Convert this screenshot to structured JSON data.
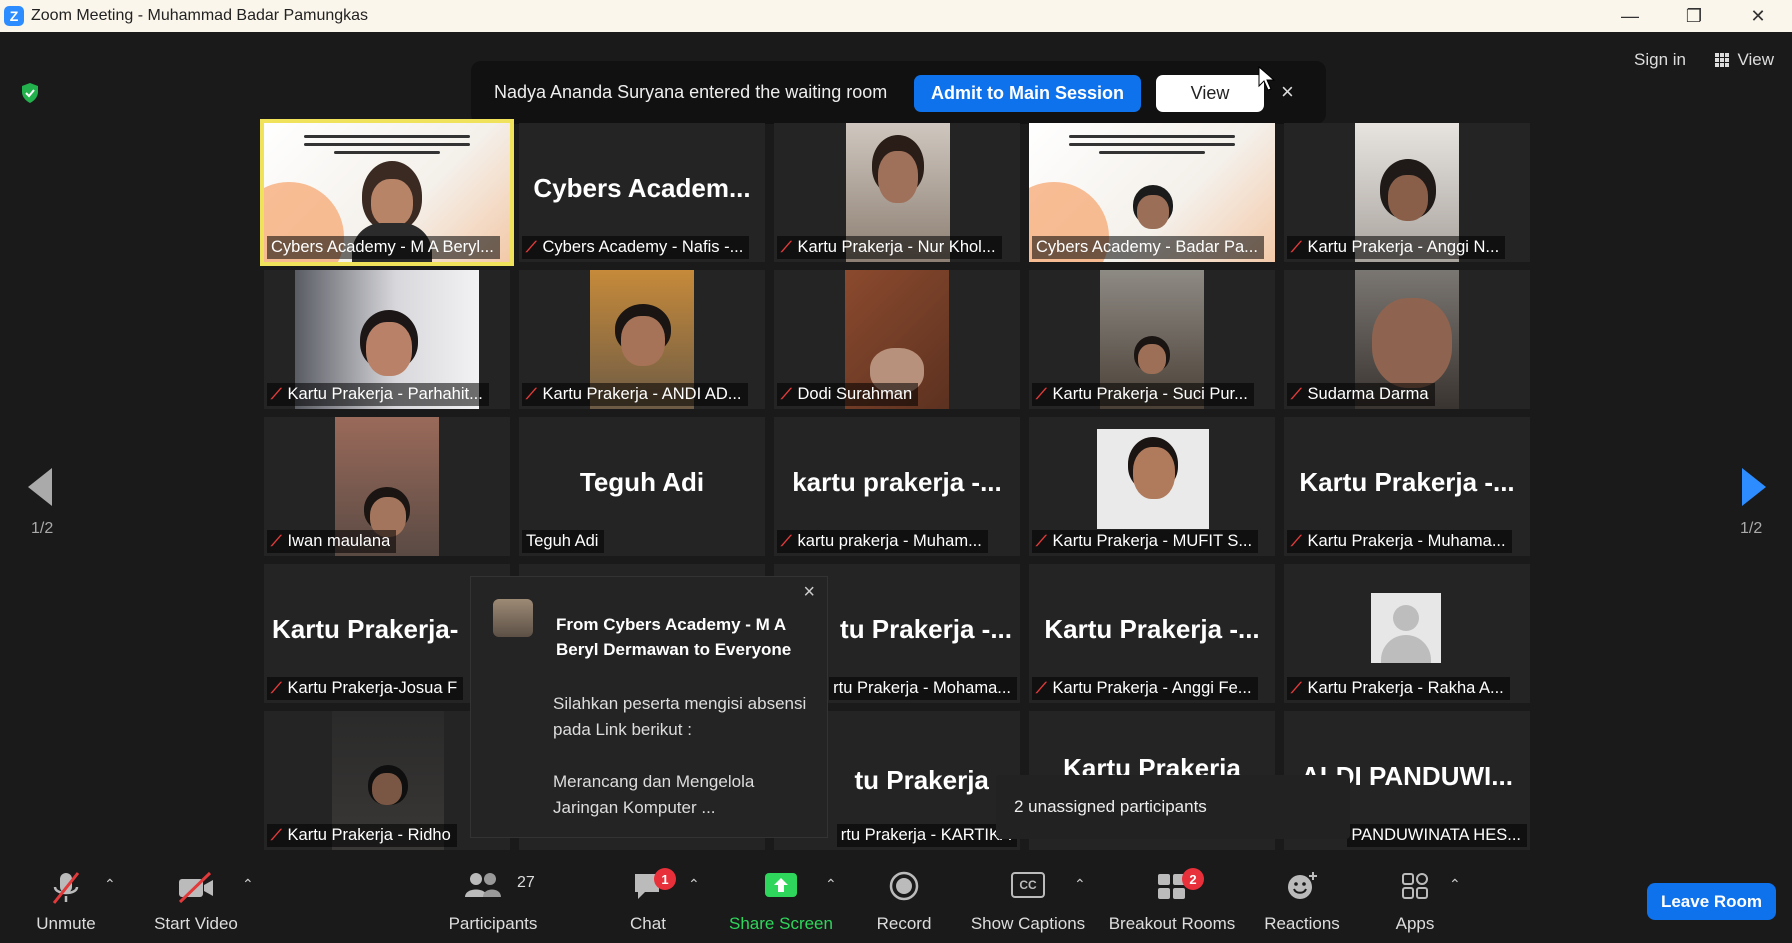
{
  "window": {
    "title": "Zoom Meeting - Muhammad Badar Pamungkas",
    "logo": "Z",
    "minimize": "—",
    "restore": "❐",
    "close": "✕"
  },
  "header": {
    "sign_in": "Sign in",
    "view": "View"
  },
  "notification": {
    "text": "Nadya Ananda Suryana entered the waiting room",
    "admit_label": "Admit to Main Session",
    "view_label": "View",
    "close": "×"
  },
  "tiles": [
    {
      "label": "Cybers Academy - M A Beryl...",
      "muted": false,
      "big": ""
    },
    {
      "label": "Cybers Academy - Nafis -...",
      "muted": true,
      "big": "Cybers  Academ..."
    },
    {
      "label": "Kartu Prakerja - Nur Khol...",
      "muted": true,
      "big": ""
    },
    {
      "label": "Cybers Academy - Badar Pa...",
      "muted": false,
      "big": ""
    },
    {
      "label": "Kartu Prakerja - Anggi N...",
      "muted": true,
      "big": ""
    },
    {
      "label": "Kartu Prakerja - Parhahit...",
      "muted": true,
      "big": ""
    },
    {
      "label": "Kartu Prakerja - ANDI AD...",
      "muted": true,
      "big": ""
    },
    {
      "label": "Dodi Surahman",
      "muted": true,
      "big": ""
    },
    {
      "label": "Kartu Prakerja - Suci Pur...",
      "muted": true,
      "big": ""
    },
    {
      "label": "Sudarma Darma",
      "muted": true,
      "big": ""
    },
    {
      "label": "Iwan maulana",
      "muted": true,
      "big": ""
    },
    {
      "label": "Teguh Adi",
      "muted": false,
      "big": "Teguh Adi"
    },
    {
      "label": "kartu prakerja - Muham...",
      "muted": true,
      "big": "kartu  prakerja  -..."
    },
    {
      "label": "Kartu Prakerja - MUFIT S...",
      "muted": true,
      "big": ""
    },
    {
      "label": "Kartu Prakerja - Muhama...",
      "muted": true,
      "big": "Kartu  Prakerja  -..."
    },
    {
      "label": "Kartu Prakerja-Josua F",
      "muted": true,
      "big": "Kartu  Prakerja-"
    },
    {
      "label": "",
      "muted": false,
      "big": ""
    },
    {
      "label": "rtu Prakerja - Mohama...",
      "muted": false,
      "big": "tu  Prakerja  -..."
    },
    {
      "label": "Kartu Prakerja - Anggi Fe...",
      "muted": true,
      "big": "Kartu  Prakerja  -..."
    },
    {
      "label": "Kartu Prakerja - Rakha A...",
      "muted": true,
      "big": ""
    },
    {
      "label": "Kartu Prakerja - Ridho",
      "muted": true,
      "big": ""
    },
    {
      "label": "",
      "muted": false,
      "big": ""
    },
    {
      "label": "rtu Prakerja - KARTIKA",
      "muted": false,
      "big": "tu  Prakerja  -."
    },
    {
      "label": "",
      "muted": false,
      "big": "Kartu  Prakerja"
    },
    {
      "label": "PANDUWINATA HES...",
      "muted": false,
      "big": "ALDI  PANDUWI..."
    }
  ],
  "pager": {
    "prev_page": "1/2",
    "next_page": "1/2"
  },
  "chat_popup": {
    "from": "From Cybers Academy - M A Beryl Dermawan to Everyone",
    "message": "Silahkan peserta mengisi absensi pada Link berikut :\n\nMerancang dan Mengelola Jaringan Komputer ...",
    "close": "×"
  },
  "tooltip": {
    "text": "2 unassigned participants"
  },
  "toolbar": {
    "unmute": "Unmute",
    "start_video": "Start Video",
    "participants": "Participants",
    "participants_count": "27",
    "chat": "Chat",
    "chat_badge": "1",
    "share_screen": "Share Screen",
    "record": "Record",
    "show_captions": "Show Captions",
    "captions_icon_text": "CC",
    "breakout_rooms": "Breakout Rooms",
    "breakout_badge": "2",
    "reactions": "Reactions",
    "apps": "Apps",
    "leave": "Leave Room",
    "caret": "⌃"
  },
  "colors": {
    "accent_blue": "#0e72ed",
    "share_green": "#2ed65b",
    "muted_red": "#e23a3a",
    "active_speaker": "#f0e25a",
    "badge_red": "#e8303a"
  }
}
